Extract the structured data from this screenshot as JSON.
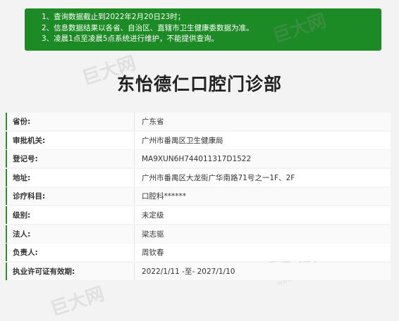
{
  "notice": {
    "lines": [
      "1、查询数据截止到2022年2月20日23时；",
      "2、信息数据结果以各省、自治区、直辖市卫生健康委数据为准。",
      "3、凌晨1点至凌晨5点系统进行维护，不能提供查询。"
    ]
  },
  "watermark": {
    "brand": "巨大网",
    "site": "www.cnjuda.com"
  },
  "title": "东怡德仁口腔门诊部",
  "fields": [
    {
      "label": "省份:",
      "value": "广东省"
    },
    {
      "label": "审批机关:",
      "value": "广州市番禺区卫生健康局"
    },
    {
      "label": "登记号:",
      "value": "MA9XUN6H744011317D1522"
    },
    {
      "label": "地址:",
      "value": "广州市番禺区大龙街广华南路71号之一1F、2F"
    },
    {
      "label": "诊疗科目:",
      "value": "口腔科******"
    },
    {
      "label": "级别:",
      "value": "未定级"
    },
    {
      "label": "法人:",
      "value": "梁志驱"
    },
    {
      "label": "负责人:",
      "value": "周钦春"
    },
    {
      "label": "执业许可证有效期:",
      "value": "2022/1/11 -至- 2027/1/10"
    }
  ]
}
